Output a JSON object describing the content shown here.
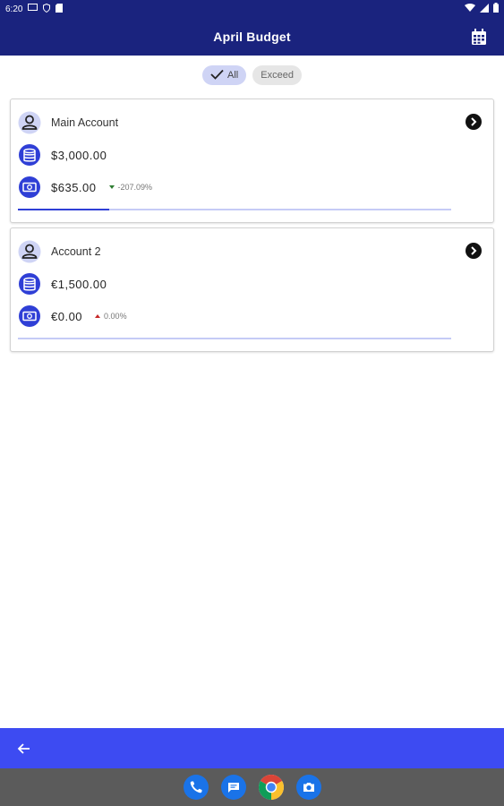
{
  "status_bar": {
    "time": "6:20"
  },
  "app_bar": {
    "title": "April Budget",
    "calendar_icon": "calendar-icon"
  },
  "filters": [
    {
      "label": "All",
      "selected": true
    },
    {
      "label": "Exceed",
      "selected": false
    }
  ],
  "accounts": [
    {
      "name": "Main Account",
      "budget": "$3,000.00",
      "spent": "$635.00",
      "change": "-207.09%",
      "change_direction": "down",
      "progress": 0.21
    },
    {
      "name": "Account 2",
      "budget": "€1,500.00",
      "spent": "€0.00",
      "change": "0.00%",
      "change_direction": "up",
      "progress": 0.0
    }
  ],
  "colors": {
    "app_bar": "#1a237e",
    "bottom_bar": "#3d4bf2",
    "chip_selected": "#cfd4f5",
    "progress_fill": "#2f3fd6",
    "progress_track": "#c5cbf6",
    "change_down": "#2e7d32",
    "change_up": "#c62828"
  },
  "dock": [
    "phone-icon",
    "messages-icon",
    "chrome-icon",
    "camera-icon"
  ]
}
